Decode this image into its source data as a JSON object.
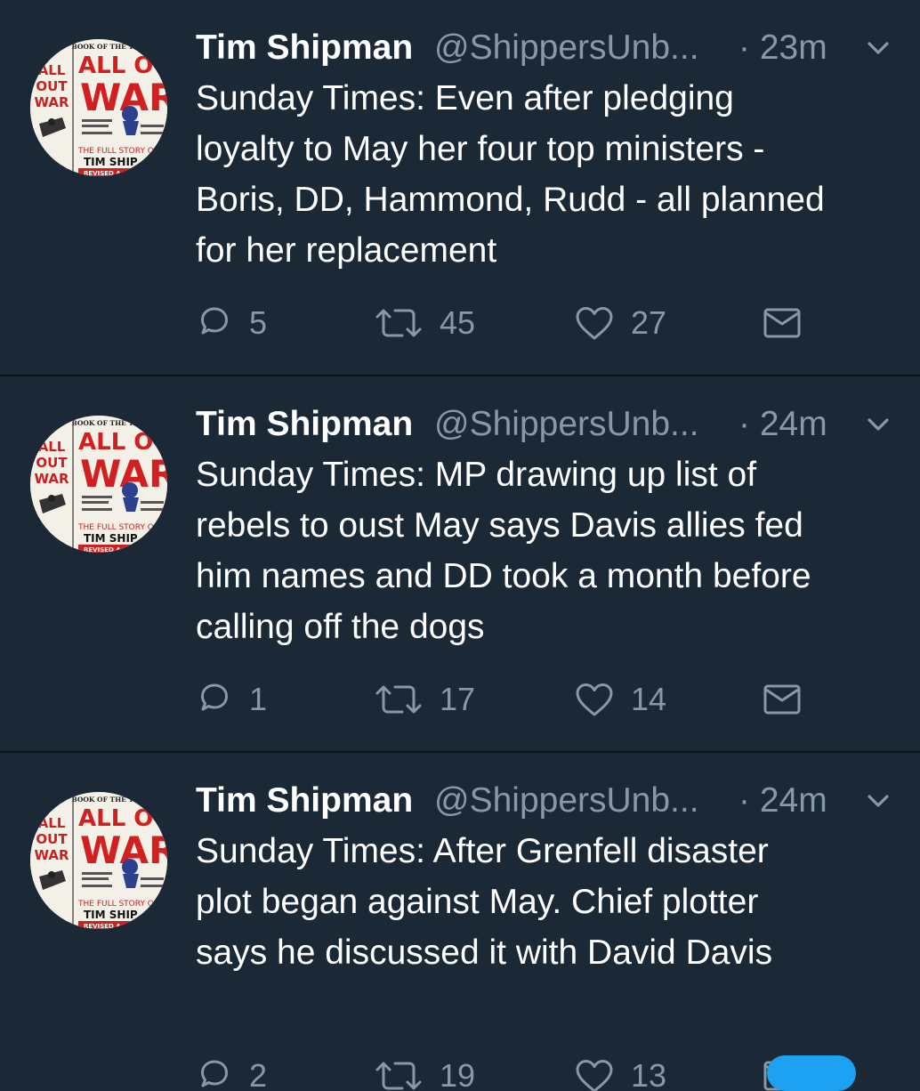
{
  "colors": {
    "background": "#1b2836",
    "divider": "#0d1318",
    "text_primary": "#ffffff",
    "text_secondary": "#8899a6",
    "accent": "#1da1f2"
  },
  "avatar": {
    "top_text": "BOOK OF THE YEAR",
    "left_col": [
      "ALL",
      "OUT",
      "WAR"
    ],
    "title_1": "ALL OU",
    "title_2": "WAR",
    "subtitle": "THE FULL STORY OF BR",
    "author": "TIM SHIP",
    "ribbon": "REVISED A"
  },
  "tweets": [
    {
      "name": "Tim Shipman",
      "handle": "@ShippersUnb...",
      "time": "· 23m",
      "text": "Sunday Times: Even after pledging\nloyalty to May her four top ministers -\nBoris, DD, Hammond, Rudd - all planned\nfor her replacement",
      "replies": "5",
      "retweets": "45",
      "likes": "27"
    },
    {
      "name": "Tim Shipman",
      "handle": "@ShippersUnb...",
      "time": "· 24m",
      "text": "Sunday Times: MP drawing up list of\nrebels to oust May says Davis allies fed\nhim names and DD took a month before\ncalling off the dogs",
      "replies": "1",
      "retweets": "17",
      "likes": "14"
    },
    {
      "name": "Tim Shipman",
      "handle": "@ShippersUnb...",
      "time": "· 24m",
      "text": "Sunday Times: After Grenfell disaster\nplot began against May. Chief plotter\nsays he discussed it with David Davis",
      "replies": "2",
      "retweets": "19",
      "likes": "13"
    }
  ],
  "icons": {
    "reply": "reply-icon",
    "retweet": "retweet-icon",
    "like": "heart-icon",
    "dm": "envelope-icon",
    "caret": "chevron-down-icon"
  }
}
